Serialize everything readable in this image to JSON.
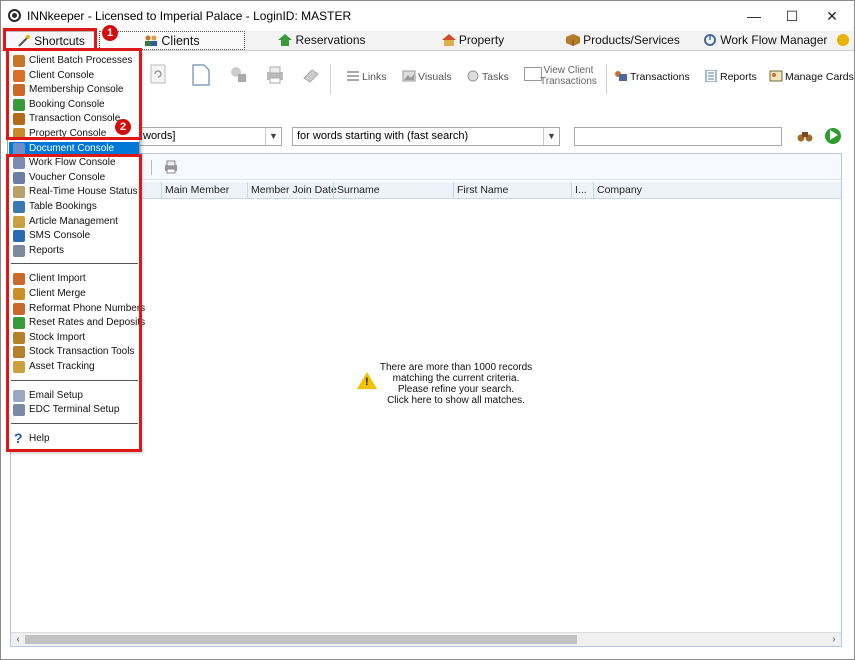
{
  "window": {
    "title": "INNkeeper - Licensed to Imperial Palace - LoginID: MASTER",
    "minimize": "—",
    "maximize": "☐",
    "close": "✕"
  },
  "tabs": [
    {
      "label": "Shortcuts",
      "icon": "wand-icon"
    },
    {
      "label": "Clients",
      "icon": "people-icon"
    },
    {
      "label": "Reservations",
      "icon": "reservation-icon"
    },
    {
      "label": "Property",
      "icon": "property-icon"
    },
    {
      "label": "Products/Services",
      "icon": "box-icon"
    },
    {
      "label": "Work Flow Manager",
      "icon": "workflow-icon"
    }
  ],
  "toolbar": {
    "links": "Links",
    "visuals": "Visuals",
    "tasks": "Tasks",
    "view_client_transactions_1": "View Client",
    "view_client_transactions_2": "Transactions",
    "transactions": "Transactions",
    "reports": "Reports",
    "manage_cards": "Manage Cards"
  },
  "search": {
    "field_combo": "words]",
    "mode_combo": "for words starting with (fast search)",
    "value": ""
  },
  "grid": {
    "columns": [
      "Main Member",
      "Member Join Date",
      "Surname",
      "First Name",
      "I...",
      "Company"
    ],
    "notice": [
      "There are more than 1000 records",
      "matching the current criteria.",
      "Please refine your search.",
      "Click here to show all matches."
    ]
  },
  "menu": {
    "group1": [
      {
        "label": "Client Batch Processes",
        "color": "#c7772a"
      },
      {
        "label": "Client Console",
        "color": "#d9702a"
      },
      {
        "label": "Membership Console",
        "color": "#c96a2a"
      },
      {
        "label": "Booking Console",
        "color": "#3a9a3a"
      },
      {
        "label": "Transaction Console",
        "color": "#b56a1a"
      },
      {
        "label": "Property Console",
        "color": "#c98a2a"
      },
      {
        "label": "Document Console",
        "color": "#6d8fc7"
      },
      {
        "label": "Work Flow Console",
        "color": "#7a8fb0"
      },
      {
        "label": "Voucher Console",
        "color": "#6d7fa0"
      },
      {
        "label": "Real-Time House Status",
        "color": "#b5a06a"
      },
      {
        "label": "Table Bookings",
        "color": "#3a7ab0"
      },
      {
        "label": "Article Management",
        "color": "#caa040"
      },
      {
        "label": "SMS Console",
        "color": "#2a6ab0"
      },
      {
        "label": "Reports",
        "color": "#7a8a9a"
      }
    ],
    "group2": [
      {
        "label": "Client Import",
        "color": "#c96a2a"
      },
      {
        "label": "Client Merge",
        "color": "#c9902a"
      },
      {
        "label": "Reformat Phone Numbers",
        "color": "#c96a2a"
      },
      {
        "label": "Reset Rates and Deposits",
        "color": "#3a9a3a"
      },
      {
        "label": "Stock Import",
        "color": "#b5802a"
      },
      {
        "label": "Stock Transaction Tools",
        "color": "#b5802a"
      },
      {
        "label": "Asset Tracking",
        "color": "#caa040"
      }
    ],
    "group3": [
      {
        "label": "Email Setup",
        "color": "#9aa8c0"
      },
      {
        "label": "EDC Terminal Setup",
        "color": "#7a8aa0"
      }
    ],
    "help": {
      "label": "Help",
      "glyph": "?"
    },
    "selected_index": 6
  },
  "annotations": {
    "badge1": "1",
    "badge2": "2",
    "color": "#e01717"
  }
}
